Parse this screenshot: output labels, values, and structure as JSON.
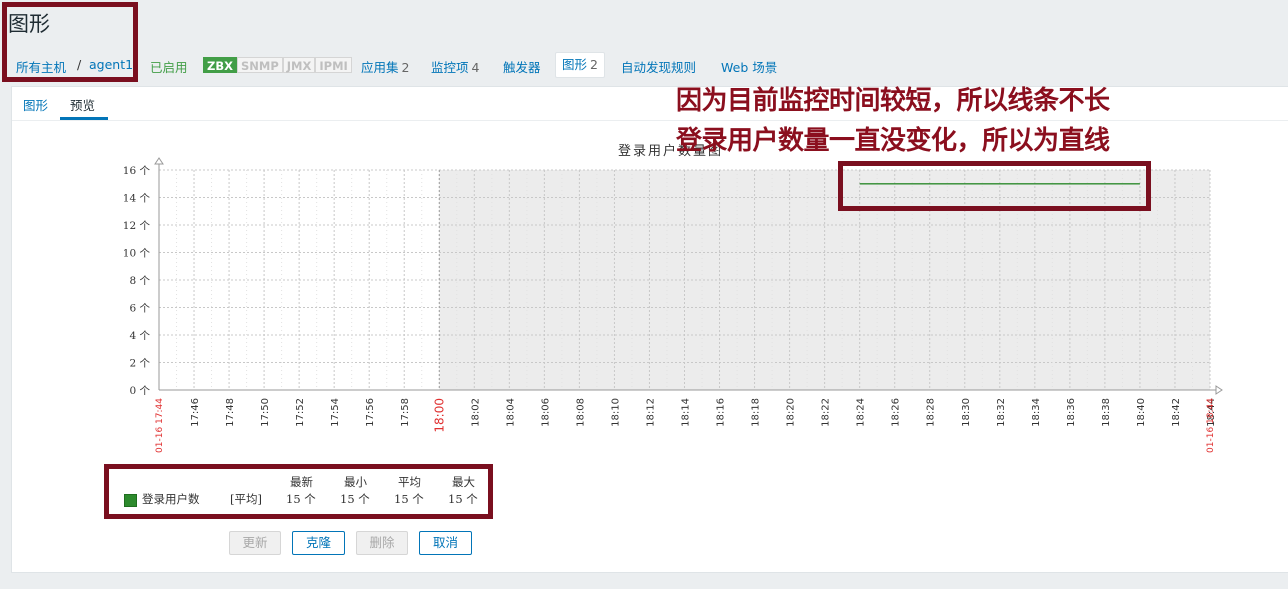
{
  "page": {
    "title": "图形"
  },
  "breadcrumb": {
    "all_hosts": "所有主机",
    "separator": "/",
    "host": "agent1"
  },
  "host_status": {
    "enabled": "已启用"
  },
  "availability": [
    "ZBX",
    "SNMP",
    "JMX",
    "IPMI"
  ],
  "nav": [
    {
      "label": "应用集",
      "count": "2"
    },
    {
      "label": "监控项",
      "count": "4"
    },
    {
      "label": "触发器",
      "count": ""
    },
    {
      "label": "图形",
      "count": "2"
    },
    {
      "label": "自动发现规则",
      "count": ""
    },
    {
      "label": "Web 场景",
      "count": ""
    }
  ],
  "tabs": [
    "图形",
    "预览"
  ],
  "annotations": {
    "line1": "因为目前监控时间较短，所以线条不长",
    "line2": "登录用户数量一直没变化，所以为直线"
  },
  "colors": {
    "series": "#2d8a2d",
    "annotation": "#8b0f1e",
    "now_marker": "#e03030"
  },
  "chart_data": {
    "type": "line",
    "title": "登录用户数量图",
    "y_ticks": [
      "0 个",
      "2 个",
      "4 个",
      "6 个",
      "8 个",
      "10 个",
      "12 个",
      "14 个",
      "16 个"
    ],
    "ylim": [
      0,
      16
    ],
    "start_label": "01-16 17:44",
    "end_label": "01-16 18:44",
    "x_ticks": [
      "17:46",
      "17:48",
      "17:50",
      "17:52",
      "17:54",
      "17:56",
      "17:58",
      "18:00",
      "18:02",
      "18:04",
      "18:06",
      "18:08",
      "18:10",
      "18:12",
      "18:14",
      "18:16",
      "18:18",
      "18:20",
      "18:22",
      "18:24",
      "18:26",
      "18:28",
      "18:30",
      "18:32",
      "18:34",
      "18:36",
      "18:38",
      "18:40",
      "18:42",
      "18:44"
    ],
    "highlight_tick": "18:00",
    "series": [
      {
        "name": "登录用户数",
        "x": [
          "18:24",
          "18:40"
        ],
        "values": [
          15,
          15
        ]
      }
    ],
    "legend": {
      "headers": [
        "最新",
        "最小",
        "平均",
        "最大"
      ],
      "name": "登录用户数",
      "func": "[平均]",
      "values": [
        "15 个",
        "15 个",
        "15 个",
        "15 个"
      ]
    }
  },
  "buttons": {
    "update": "更新",
    "clone": "克隆",
    "delete": "删除",
    "cancel": "取消"
  }
}
